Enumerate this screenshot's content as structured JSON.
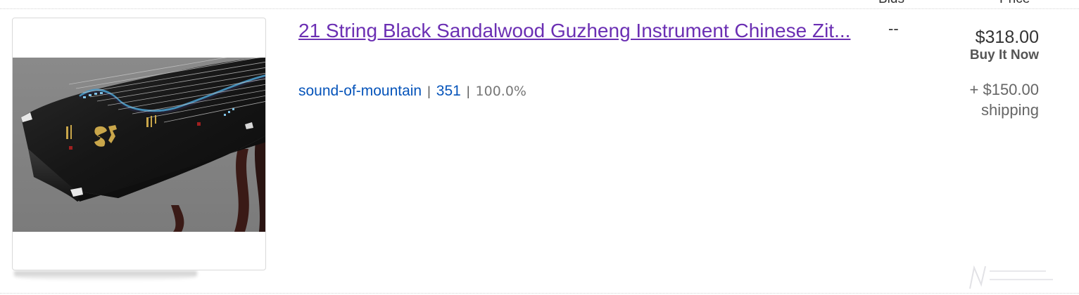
{
  "columns": {
    "bids_header": "Bids",
    "price_header": "Price"
  },
  "listing": {
    "title": "21 String Black Sandalwood Guzheng Instrument Chinese Zit...",
    "image_alt": "guzheng-photo",
    "seller": {
      "name": "sound-of-mountain",
      "feedback_score": "351",
      "feedback_percent": "100.0%"
    },
    "bids": "--",
    "price": "$318.00",
    "format": "Buy It Now",
    "shipping_cost": "+ $150.00",
    "shipping_label": "shipping"
  },
  "colors": {
    "visited_link": "#6b2fb3",
    "seller_link": "#0654ba"
  }
}
